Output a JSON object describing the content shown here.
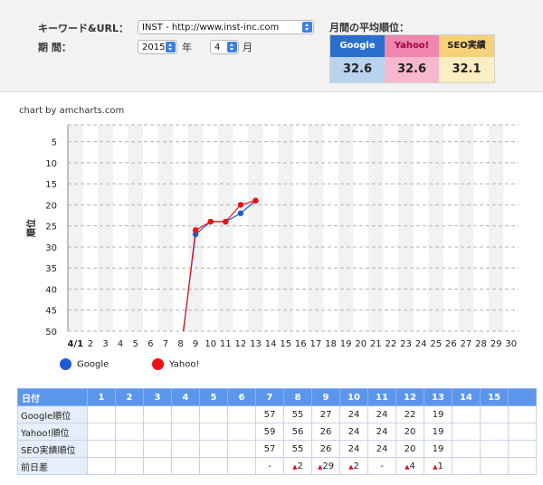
{
  "filters": {
    "keyword_label": "キーワード&URL：",
    "keyword_value": "INST - http://www.inst-inc.com",
    "period_label": "期 間：",
    "year_value": "2015",
    "year_unit": "年",
    "month_value": "4",
    "month_unit": "月"
  },
  "monthly": {
    "title": "月間の平均順位：",
    "engines": [
      {
        "name": "Google",
        "value": "32.6",
        "head_color": "#2a6fc9",
        "head_text": "#ffffff",
        "val_color": "#b9d2ee"
      },
      {
        "name": "Yahoo!",
        "value": "32.6",
        "head_color": "#ef86ad",
        "head_text": "#a3003e",
        "val_color": "#f7b8cf"
      },
      {
        "name": "SEO実績",
        "value": "32.1",
        "head_color": "#f5d27a",
        "head_text": "#222222",
        "val_color": "#fbeec3"
      }
    ]
  },
  "chart_credit": "chart by amcharts.com",
  "chart_data": {
    "type": "line",
    "ylabel": "順位",
    "y_inverted": true,
    "ylim": [
      50,
      1
    ],
    "y_ticks": [
      "5",
      "10",
      "15",
      "20",
      "25",
      "30",
      "35",
      "40",
      "45",
      "50"
    ],
    "y_tick_values": [
      5,
      10,
      15,
      20,
      25,
      30,
      35,
      40,
      45,
      50
    ],
    "categories": [
      "4/1",
      "2",
      "3",
      "4",
      "5",
      "6",
      "7",
      "8",
      "9",
      "10",
      "11",
      "12",
      "13",
      "14",
      "15",
      "16",
      "17",
      "18",
      "19",
      "20",
      "21",
      "22",
      "23",
      "24",
      "25",
      "26",
      "27",
      "28",
      "29",
      "30"
    ],
    "grid": true,
    "series": [
      {
        "name": "Google",
        "color": "#1e5ad2",
        "values": [
          null,
          null,
          null,
          null,
          null,
          null,
          57,
          55,
          27,
          24,
          24,
          22,
          19,
          null,
          null,
          null,
          null,
          null,
          null,
          null,
          null,
          null,
          null,
          null,
          null,
          null,
          null,
          null,
          null,
          null
        ]
      },
      {
        "name": "Yahoo!",
        "color": "#ee1111",
        "values": [
          null,
          null,
          null,
          null,
          null,
          null,
          59,
          56,
          26,
          24,
          24,
          20,
          19,
          null,
          null,
          null,
          null,
          null,
          null,
          null,
          null,
          null,
          null,
          null,
          null,
          null,
          null,
          null,
          null,
          null
        ]
      }
    ]
  },
  "legend": [
    {
      "name": "Google",
      "color": "#1e5ad2"
    },
    {
      "name": "Yahoo!",
      "color": "#ee1111"
    }
  ],
  "table": {
    "corner": "日付",
    "days": [
      "1",
      "2",
      "3",
      "4",
      "5",
      "6",
      "7",
      "8",
      "9",
      "10",
      "11",
      "12",
      "13",
      "14",
      "15"
    ],
    "rows": [
      {
        "label": "Google順位",
        "cells": [
          "",
          "",
          "",
          "",
          "",
          "",
          "57",
          "55",
          "27",
          "24",
          "24",
          "22",
          "19",
          "",
          ""
        ]
      },
      {
        "label": "Yahoo!順位",
        "cells": [
          "",
          "",
          "",
          "",
          "",
          "",
          "59",
          "56",
          "26",
          "24",
          "24",
          "20",
          "19",
          "",
          ""
        ]
      },
      {
        "label": "SEO実績順位",
        "cells": [
          "",
          "",
          "",
          "",
          "",
          "",
          "57",
          "55",
          "26",
          "24",
          "24",
          "20",
          "19",
          "",
          ""
        ]
      }
    ],
    "diff_label": "前日差",
    "diff_cells": [
      {
        "text": ""
      },
      {
        "text": ""
      },
      {
        "text": ""
      },
      {
        "text": ""
      },
      {
        "text": ""
      },
      {
        "text": ""
      },
      {
        "text": "-"
      },
      {
        "arrow": "▲",
        "text": "2"
      },
      {
        "arrow": "▲",
        "text": "29"
      },
      {
        "arrow": "▲",
        "text": "2"
      },
      {
        "text": "-"
      },
      {
        "arrow": "▲",
        "text": "4"
      },
      {
        "arrow": "▲",
        "text": "1"
      },
      {
        "text": ""
      },
      {
        "text": ""
      }
    ]
  }
}
